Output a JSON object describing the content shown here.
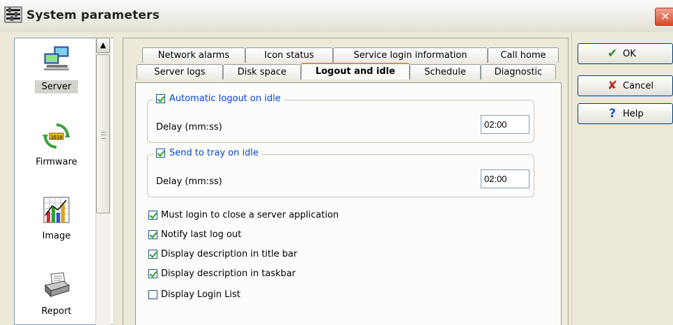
{
  "window": {
    "title": "System parameters",
    "close_symbol": "✕"
  },
  "sidebar": {
    "items": [
      {
        "label": "Server",
        "icon": "server-icon",
        "selected": true
      },
      {
        "label": "Firmware",
        "icon": "firmware-icon",
        "selected": false
      },
      {
        "label": "Image",
        "icon": "image-chart-icon",
        "selected": false
      },
      {
        "label": "Report",
        "icon": "printer-icon",
        "selected": false
      }
    ]
  },
  "tabs": {
    "row1": [
      "Network alarms",
      "Icon status",
      "Service login information",
      "Call home"
    ],
    "row2": [
      "Server logs",
      "Disk space",
      "Logout and idle",
      "Schedule",
      "Diagnostic"
    ],
    "active": "Logout and idle"
  },
  "logout_page": {
    "auto_logout": {
      "label": "Automatic logout on idle",
      "checked": true,
      "delay_label": "Delay (mm:ss)",
      "delay_value": "02:00"
    },
    "send_tray": {
      "label": "Send to tray on idle",
      "checked": true,
      "delay_label": "Delay (mm:ss)",
      "delay_value": "02:00"
    },
    "options": [
      {
        "label": "Must login to close a server application",
        "checked": true
      },
      {
        "label": "Notify last log out",
        "checked": true
      },
      {
        "label": "Display description in title bar",
        "checked": true
      },
      {
        "label": "Display description in taskbar",
        "checked": true
      },
      {
        "label": "Display Login List",
        "checked": false
      }
    ]
  },
  "buttons": {
    "ok": {
      "label": "OK",
      "icon": "checkmark-icon",
      "symbol": "✔",
      "color": "#2e8b23"
    },
    "cancel": {
      "label": "Cancel",
      "icon": "x-mark-icon",
      "symbol": "✘",
      "color": "#c8281e"
    },
    "help": {
      "label": "Help",
      "icon": "question-icon",
      "symbol": "?",
      "color": "#1f5bb8"
    }
  }
}
